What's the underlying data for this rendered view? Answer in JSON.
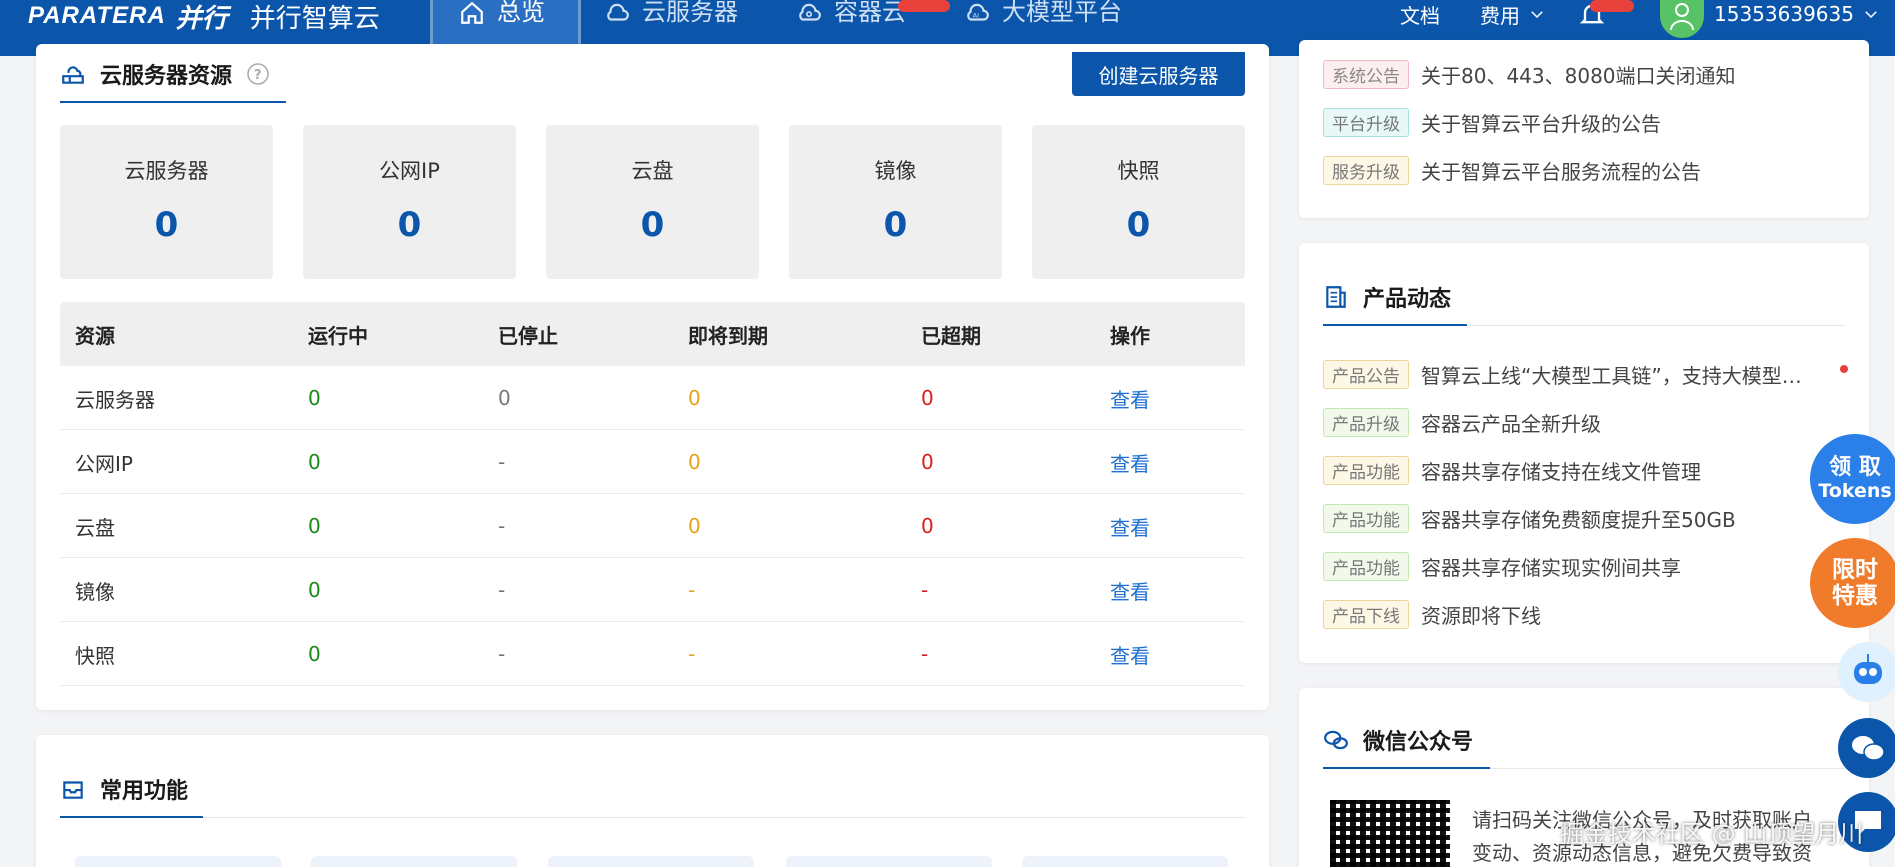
{
  "topbar": {
    "logo_brand": "PARATERA",
    "logo_cn": "并行",
    "logo_name": "并行智算云",
    "nav": [
      {
        "label": "总览",
        "icon": "home-icon",
        "active": true
      },
      {
        "label": "云服务器",
        "icon": "cloud-icon",
        "active": false
      },
      {
        "label": "容器云",
        "icon": "container-cloud-icon",
        "active": false
      },
      {
        "label": "大模型平台",
        "icon": "ai-model-icon",
        "active": false
      }
    ],
    "docs_label": "文档",
    "billing_label": "费用",
    "user_phone": "15353639635"
  },
  "cloud_resources": {
    "title": "云服务器资源",
    "create_button": "创建云服务器",
    "stats": [
      {
        "label": "云服务器",
        "value": "0"
      },
      {
        "label": "公网IP",
        "value": "0"
      },
      {
        "label": "云盘",
        "value": "0"
      },
      {
        "label": "镜像",
        "value": "0"
      },
      {
        "label": "快照",
        "value": "0"
      }
    ],
    "table": {
      "headers": [
        "资源",
        "运行中",
        "已停止",
        "即将到期",
        "已超期",
        "操作"
      ],
      "rows": [
        {
          "name": "云服务器",
          "running": "0",
          "stopped": "0",
          "expiring": "0",
          "expired": "0",
          "action": "查看"
        },
        {
          "name": "公网IP",
          "running": "0",
          "stopped": "-",
          "expiring": "0",
          "expired": "0",
          "action": "查看"
        },
        {
          "name": "云盘",
          "running": "0",
          "stopped": "-",
          "expiring": "0",
          "expired": "0",
          "action": "查看"
        },
        {
          "name": "镜像",
          "running": "0",
          "stopped": "-",
          "expiring": "-",
          "expired": "-",
          "action": "查看"
        },
        {
          "name": "快照",
          "running": "0",
          "stopped": "-",
          "expiring": "-",
          "expired": "-",
          "action": "查看"
        }
      ]
    }
  },
  "common_functions": {
    "title": "常用功能"
  },
  "announcements": [
    {
      "tag": "系统公告",
      "text": "关于80、443、8080端口关闭通知"
    },
    {
      "tag": "平台升级",
      "text": "关于智算云平台升级的公告"
    },
    {
      "tag": "服务升级",
      "text": "关于智算云平台服务流程的公告"
    }
  ],
  "product_news": {
    "title": "产品动态",
    "items": [
      {
        "tag": "产品公告",
        "text": "智算云上线“大模型工具链”，支持大模型…"
      },
      {
        "tag": "产品升级",
        "text": "容器云产品全新升级"
      },
      {
        "tag": "产品功能",
        "text": "容器共享存储支持在线文件管理"
      },
      {
        "tag": "产品功能",
        "text": "容器共享存储免费额度提升至50GB"
      },
      {
        "tag": "产品功能",
        "text": "容器共享存储实现实例间共享"
      },
      {
        "tag": "产品下线",
        "text": "资源即将下线"
      }
    ]
  },
  "wechat": {
    "title": "微信公众号",
    "desc_line1": "请扫码关注微信公众号，及时获取账户",
    "desc_line2": "变动、资源动态信息，避免欠费导致资"
  },
  "floating": {
    "tokens_line1": "领 取",
    "tokens_line2": "Tokens",
    "promo_line1": "限时",
    "promo_line2": "特惠"
  },
  "watermark": "掘金技术社区 @ 山顶望月川"
}
